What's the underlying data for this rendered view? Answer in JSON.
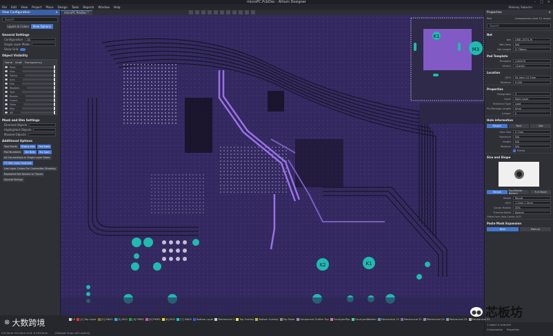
{
  "window": {
    "title": "microPC.PcbDoc - Altium Designer",
    "controls": [
      "–",
      "□",
      "×"
    ]
  },
  "menu": {
    "items": [
      "File",
      "Edit",
      "View",
      "Project",
      "Place",
      "Design",
      "Tools",
      "Reports",
      "Window",
      "Help"
    ],
    "user": "Aleksey Sabunin"
  },
  "doc_tab": "microPC.PcbDoc *",
  "left_panel": {
    "title": "View Configuration",
    "search_placeholder": "Search",
    "toggle": [
      "Layers & Colors",
      "View Options"
    ],
    "general_title": "General Settings",
    "configuration_label": "Configuration",
    "configuration_value": "2D",
    "single_layer_label": "Single Layer Mode",
    "show_grid_label": "Show Grid",
    "visibility_title": "Object Visibility",
    "vis_cols": [
      "Name",
      "Draft",
      "Transparency"
    ],
    "vis_rows": [
      "Pads",
      "Vias",
      "Tracks",
      "Arcs",
      "Fills",
      "Regions",
      "Text",
      "Rooms",
      "Coord.",
      "Dims",
      "Poly",
      "3D"
    ],
    "mask_title": "Mask and Dim Settings",
    "mask_rows": [
      "Dimmed Objects",
      "Highlighted Objects",
      "Masked Objects"
    ],
    "additional_title": "Additional Options",
    "options": [
      "Test Points",
      "Status Info",
      "Pad Nets",
      "Pad Numbers",
      "Via Nets",
      "Via Span",
      "All Connections in Single Layer Mode",
      "TT: Net Color Override",
      "Use Layer Colors For Connection Drawing",
      "Repeated Net Names on Tracks",
      "Special Strings"
    ]
  },
  "right_panel": {
    "title": "Properties",
    "context": "Pad",
    "components": "Components (and 12 more)",
    "search_placeholder": "Search",
    "net_title": "Net",
    "net_fields": [
      {
        "k": "Net",
        "v": "USB1_SSTX_M"
      },
      {
        "k": "Net Class",
        "v": "N/A"
      },
      {
        "k": "Net Length",
        "v": "5.736mm"
      }
    ],
    "template_title": "Pad Template",
    "template_fields": [
      {
        "k": "Template",
        "v": "c140h70"
      },
      {
        "k": "Library",
        "v": "<Local>"
      }
    ],
    "location_title": "Location",
    "location_fields": [
      {
        "k": "(X/Y)",
        "v": "94.4mm  12.7mm"
      },
      {
        "k": "Rotation",
        "v": "0.000"
      }
    ],
    "properties_title": "Properties",
    "prop_fields": [
      {
        "k": "Designator",
        "v": "3"
      },
      {
        "k": "Layer",
        "v": "Multi-Layer"
      },
      {
        "k": "Electrical Type",
        "v": "Load"
      },
      {
        "k": "Pin/Package Length",
        "v": "0mm"
      },
      {
        "k": "Jumper",
        "v": "0"
      }
    ],
    "hole_title": "Hole information",
    "hole_shapes": [
      "Round",
      "Rect",
      "Slot"
    ],
    "hole_fields": [
      {
        "k": "Hole Size",
        "v": "0.7mm"
      },
      {
        "k": "Tolerance",
        "v": "N/A"
      },
      {
        "k": "Length",
        "v": "N/A"
      },
      {
        "k": "Rotation",
        "v": "N/A"
      }
    ],
    "plated_label": "Plated",
    "size_title": "Size and Shape",
    "stack_modes": [
      "Simple",
      "Top-Middle-Bottom",
      "Full Stack"
    ],
    "size_fields": [
      {
        "k": "Shape",
        "v": "Round"
      },
      {
        "k": "(X/Y)",
        "v": "1.2mm  1.2mm"
      },
      {
        "k": "Corner Radius",
        "v": "50%"
      },
      {
        "k": "Thermal Relief",
        "v": "Normal"
      }
    ],
    "offset_label": "Offset From Hole Center (X/Y)",
    "paste_title": "Paste Mask Expansion",
    "paste_modes": [
      "Rule",
      "Manual"
    ],
    "selection_info": "1 object is selected",
    "bottom_tabs": [
      "Components",
      "Properties"
    ]
  },
  "layer_tabs": [
    {
      "name": "LS",
      "color": "#d4d4d4"
    },
    {
      "name": "[1] Top Layer",
      "color": "#ff2b2b"
    },
    {
      "name": "[2] GND1",
      "color": "#9b6b2f"
    },
    {
      "name": "[3] SIG1",
      "color": "#2fa7ff"
    },
    {
      "name": "[4] PWR1",
      "color": "#1aa34a"
    },
    {
      "name": "[5] PWR2",
      "color": "#c35bd0"
    },
    {
      "name": "[6] SIG2",
      "color": "#f5d33b"
    },
    {
      "name": "[7] GND2",
      "color": "#00ced1"
    },
    {
      "name": "Bottom Layer",
      "color": "#3355ff"
    },
    {
      "name": "Mechanical 1",
      "color": "#c9c9ff"
    },
    {
      "name": "Top Overlay",
      "color": "#f4e84d"
    },
    {
      "name": "Bottom Overlay",
      "color": "#c9b34a"
    },
    {
      "name": "Top Paste",
      "color": "#8c8c8c"
    },
    {
      "name": "Component Outline Top",
      "color": "#b57bd6"
    },
    {
      "name": "CourtyardTop",
      "color": "#d670c9"
    },
    {
      "name": "CourtyardBottom",
      "color": "#4fd0a3"
    },
    {
      "name": "Mechanical 15",
      "color": "#5a9adb"
    },
    {
      "name": "Mechanical 22",
      "color": "#8e5fb6"
    },
    {
      "name": "Mechanical 24",
      "color": "#9a7fd0"
    },
    {
      "name": "Mechanical 25",
      "color": "#6fa1c7"
    },
    {
      "name": "Mechanical 31",
      "color": "#b0b0b0"
    }
  ],
  "status": {
    "coords": "X:0.0mm Y:0.0mm  Grid: 0.0254mm",
    "snap": "(Hotspot Snap (All Layers))"
  },
  "board_labels": {
    "k1": "K1",
    "k2": "K2",
    "m3": "M3",
    "r1": "K1"
  },
  "watermark_left": "大数跨境",
  "watermark_right": "芯板坊"
}
